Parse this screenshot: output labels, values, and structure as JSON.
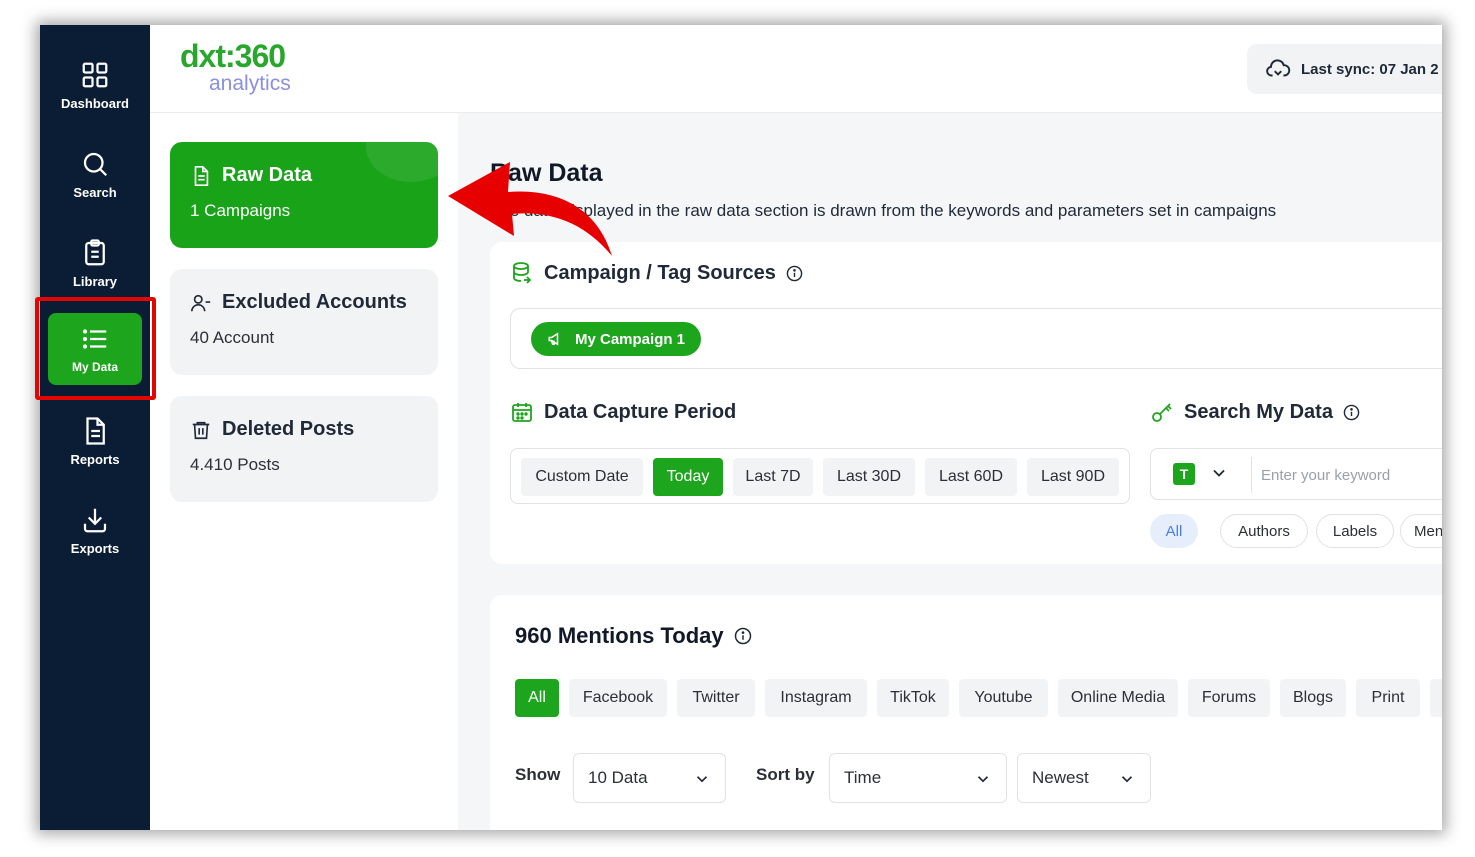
{
  "sidebar": {
    "items": [
      {
        "label": "Dashboard",
        "icon": "grid-icon"
      },
      {
        "label": "Search",
        "icon": "search-icon"
      },
      {
        "label": "Library",
        "icon": "clipboard-icon"
      },
      {
        "label": "My Data",
        "icon": "list-icon",
        "active": true
      },
      {
        "label": "Reports",
        "icon": "document-icon"
      },
      {
        "label": "Exports",
        "icon": "download-icon"
      }
    ]
  },
  "header": {
    "logo_top": "dxt:360",
    "logo_bottom": "analytics",
    "sync_text": "Last sync: 07 Jan 2"
  },
  "cards": [
    {
      "title": "Raw Data",
      "subtitle": "1 Campaigns",
      "icon": "file-icon",
      "active": true
    },
    {
      "title": "Excluded Accounts",
      "subtitle": "40 Account",
      "icon": "user-minus-icon"
    },
    {
      "title": "Deleted Posts",
      "subtitle": "4.410 Posts",
      "icon": "trash-icon"
    }
  ],
  "main": {
    "title": "Raw Data",
    "description": "The data displayed in the raw data section is drawn from the keywords and parameters set in campaigns",
    "campaign_sources": {
      "title": "Campaign / Tag Sources",
      "chips": [
        "My Campaign 1"
      ]
    },
    "capture_period": {
      "title": "Data Capture Period",
      "options": [
        "Custom Date",
        "Today",
        "Last 7D",
        "Last 30D",
        "Last 60D",
        "Last 90D"
      ],
      "selected": "Today"
    },
    "search": {
      "title": "Search My Data",
      "type_badge": "T",
      "placeholder": "Enter your keyword",
      "filters": [
        "All",
        "Authors",
        "Labels",
        "Men"
      ],
      "selected_filter": "All"
    },
    "mentions": {
      "title": "960 Mentions Today",
      "sources": [
        "All",
        "Facebook",
        "Twitter",
        "Instagram",
        "TikTok",
        "Youtube",
        "Online Media",
        "Forums",
        "Blogs",
        "Print"
      ],
      "selected_source": "All",
      "show_label": "Show",
      "show_value": "10 Data",
      "sort_label": "Sort by",
      "sort_value": "Time",
      "order_value": "Newest"
    }
  },
  "colors": {
    "brand_green": "#1ea51e",
    "sidebar_bg": "#0b1d35",
    "highlight_red": "#e10600"
  }
}
